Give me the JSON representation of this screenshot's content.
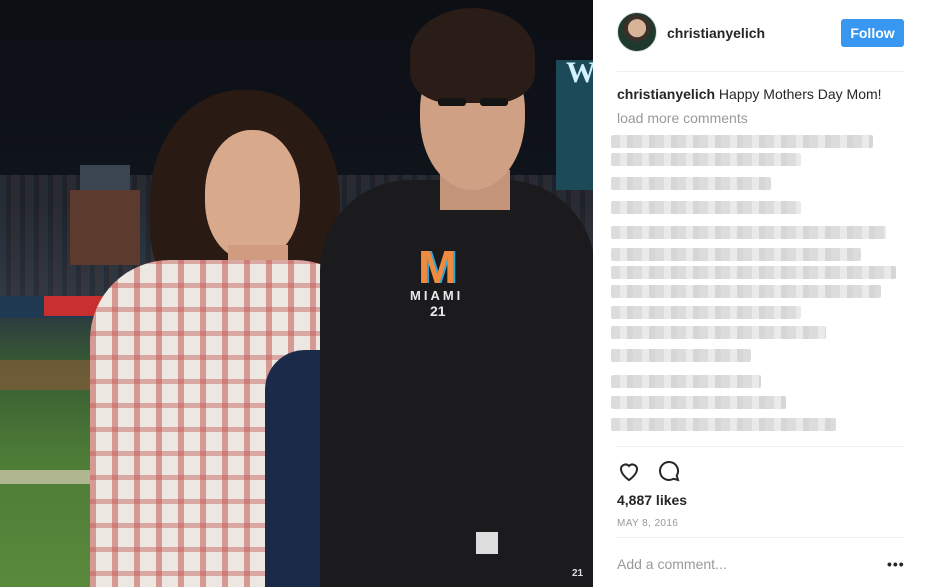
{
  "post": {
    "username": "christianyelich",
    "follow_label": "Follow",
    "caption_user": "christianyelich",
    "caption_text": " Happy Mothers Day Mom!",
    "load_more": "load more comments",
    "likes": "4,887 likes",
    "date": "MAY 8, 2016",
    "comment_placeholder": "Add a comment...",
    "more_label": "•••"
  },
  "photo": {
    "jersey_text": "MIAMI",
    "jersey_number": "21",
    "sign_letter": "W",
    "sleeve_number": "21"
  },
  "icons": {
    "like": "heart-icon",
    "comment": "comment-bubble-icon",
    "more": "more-options-icon"
  },
  "colors": {
    "follow_button": "#3897f0",
    "muted_text": "#999999",
    "primary_text": "#262626"
  }
}
